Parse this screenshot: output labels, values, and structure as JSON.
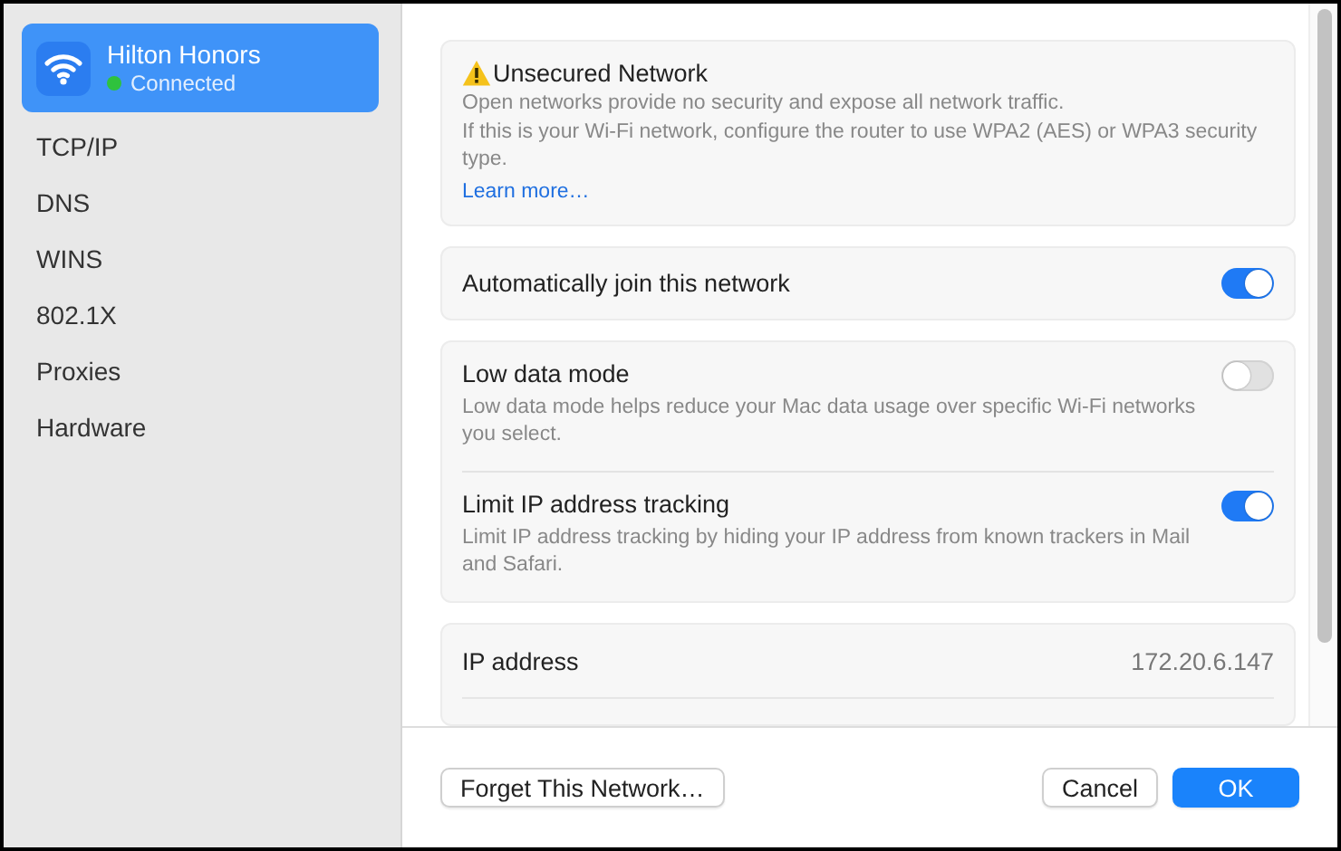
{
  "sidebar": {
    "network": {
      "name": "Hilton Honors",
      "status": "Connected",
      "selected": true
    },
    "items": [
      {
        "label": "TCP/IP",
        "selected": false
      },
      {
        "label": "DNS",
        "selected": false
      },
      {
        "label": "WINS",
        "selected": false
      },
      {
        "label": "802.1X",
        "selected": false
      },
      {
        "label": "Proxies",
        "selected": false
      },
      {
        "label": "Hardware",
        "selected": false
      }
    ]
  },
  "warning": {
    "title": "Unsecured Network",
    "lines": [
      "Open networks provide no security and expose all network traffic.",
      "If this is your Wi-Fi network, configure the router to use WPA2 (AES) or WPA3 security type."
    ],
    "link": "Learn more…"
  },
  "groups": [
    [
      {
        "label": "Automatically join this network",
        "on": true
      }
    ],
    [
      {
        "label": "Low data mode",
        "description": "Low data mode helps reduce your Mac data usage over specific Wi-Fi networks you select.",
        "on": false
      },
      {
        "label": "Limit IP address tracking",
        "description": "Limit IP address tracking by hiding your IP address from known trackers in Mail and Safari.",
        "on": true
      }
    ]
  ],
  "details": [
    {
      "label": "IP address",
      "value": "172.20.6.147"
    }
  ],
  "buttons": {
    "forget": "Forget This Network…",
    "cancel": "Cancel",
    "ok": "OK"
  }
}
